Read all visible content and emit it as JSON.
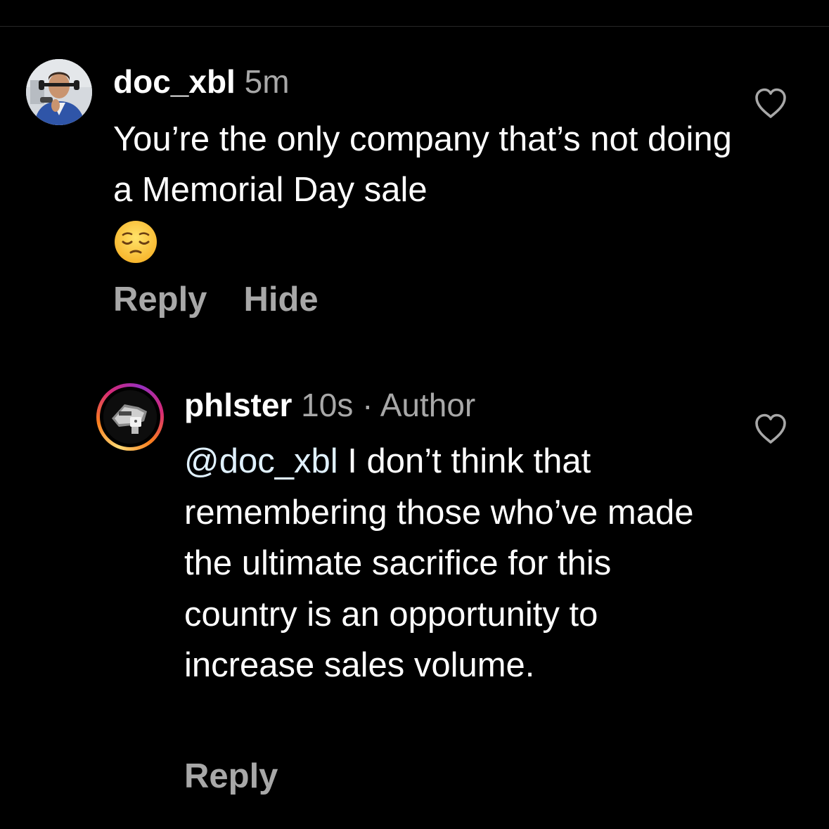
{
  "comments": [
    {
      "username": "doc_xbl",
      "time": "5m",
      "text": "You’re the only company that’s not doing a Memorial Day sale",
      "emoji_icon": "pensive-face-icon",
      "actions": {
        "reply": "Reply",
        "hide": "Hide"
      },
      "liked": false
    }
  ],
  "reply": {
    "username": "phlster",
    "time": "10s",
    "separator": "·",
    "badge": "Author",
    "mention": "@doc_xbl",
    "text": " I don’t think that remembering those who’ve made the ultimate sacrifice for this country is an opportunity to increase sales volume.",
    "actions": {
      "reply": "Reply"
    },
    "liked": false
  },
  "colors": {
    "background": "#000000",
    "text": "#ffffff",
    "secondary_text": "#a8a8a8",
    "mention": "#e0f1ff",
    "divider": "#262626"
  }
}
